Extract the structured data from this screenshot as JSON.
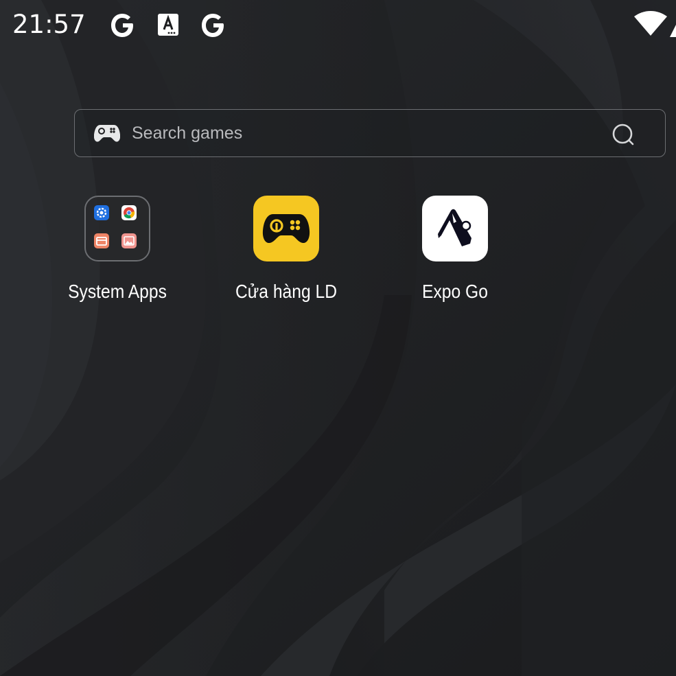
{
  "status_bar": {
    "time": "21:57",
    "icons": [
      "google-g-icon",
      "accessibility-a-icon",
      "google-g-icon",
      "wifi-icon",
      "signal-icon"
    ]
  },
  "search": {
    "placeholder": "Search games",
    "left_icon": "gamepad-icon",
    "right_icon": "search-icon"
  },
  "apps": [
    {
      "label": "System Apps",
      "type": "folder",
      "contents": [
        "settings-icon",
        "chrome-icon",
        "wallet-icon",
        "gallery-icon"
      ]
    },
    {
      "label": "Cửa hàng LD",
      "type": "app",
      "icon": "ld-gamepad-icon",
      "color": "#f5c722"
    },
    {
      "label": "Expo Go",
      "type": "app",
      "icon": "expo-icon",
      "color": "#ffffff"
    }
  ]
}
